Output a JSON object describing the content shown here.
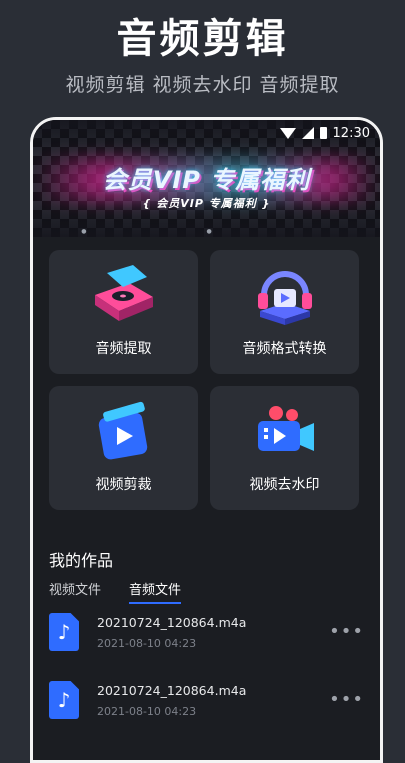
{
  "promo": {
    "title": "音频剪辑",
    "subtitle": "视频剪辑 视频去水印 音频提取"
  },
  "statusbar": {
    "time": "12:30"
  },
  "banner": {
    "title": "会员VIP 专属福利",
    "subtitle": "{ 会员VIP  专属福利 }"
  },
  "features": [
    {
      "label": "音频提取",
      "icon": "turntable-icon"
    },
    {
      "label": "音频格式转换",
      "icon": "headphones-icon"
    },
    {
      "label": "视频剪裁",
      "icon": "play-clip-icon"
    },
    {
      "label": "视频去水印",
      "icon": "video-camera-icon"
    }
  ],
  "works": {
    "title": "我的作品",
    "tabs": [
      {
        "label": "视频文件",
        "active": false
      },
      {
        "label": "音频文件",
        "active": true
      }
    ],
    "files": [
      {
        "name": "20210724_120864.m4a",
        "date": "2021-08-10 04:23"
      },
      {
        "name": "20210724_120864.m4a",
        "date": "2021-08-10 04:23"
      }
    ]
  },
  "colors": {
    "accent": "#2f6cff",
    "background": "#1b1d22",
    "card": "#2b2e35"
  }
}
